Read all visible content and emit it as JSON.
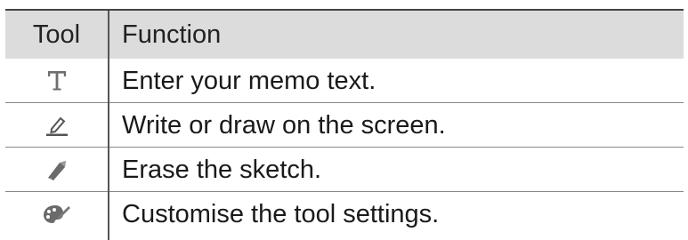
{
  "header": {
    "tool": "Tool",
    "function": "Function"
  },
  "rows": [
    {
      "icon": "text-tool-icon",
      "function": "Enter your memo text."
    },
    {
      "icon": "pen-tool-icon",
      "function": "Write or draw on the screen."
    },
    {
      "icon": "eraser-tool-icon",
      "function": "Erase the sketch."
    },
    {
      "icon": "palette-settings-icon",
      "function": "Customise the tool settings."
    }
  ]
}
